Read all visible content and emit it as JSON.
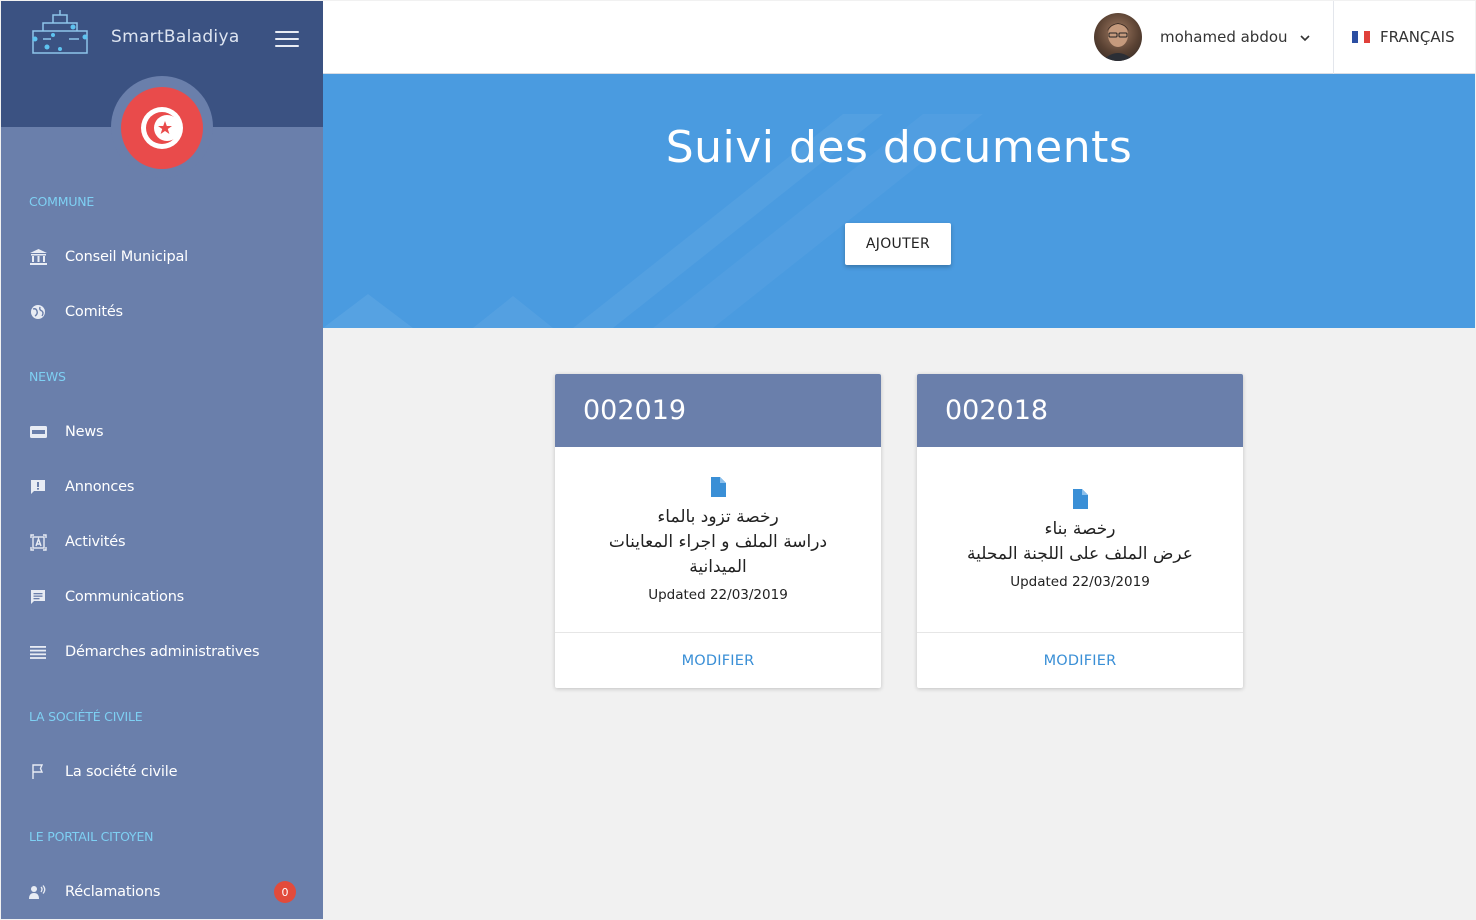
{
  "app": {
    "brand": "SmartBaladiya"
  },
  "sidebar": {
    "sections": [
      {
        "title": "COMMUNE",
        "items": [
          {
            "label": "Conseil Municipal",
            "icon": "bank-icon"
          },
          {
            "label": "Comités",
            "icon": "globe-icon"
          }
        ]
      },
      {
        "title": "NEWS",
        "items": [
          {
            "label": "News",
            "icon": "new-badge-icon"
          },
          {
            "label": "Annonces",
            "icon": "announcement-icon"
          },
          {
            "label": "Activités",
            "icon": "activity-icon"
          },
          {
            "label": "Communications",
            "icon": "message-icon"
          },
          {
            "label": "Démarches administratives",
            "icon": "list-icon"
          }
        ]
      },
      {
        "title": "LA SOCIÉTÉ CIVILE",
        "items": [
          {
            "label": "La société civile",
            "icon": "flag-icon"
          }
        ]
      },
      {
        "title": "LE PORTAIL CITOYEN",
        "items": [
          {
            "label": "Réclamations",
            "icon": "speaker-person-icon",
            "badge": "0"
          }
        ]
      }
    ]
  },
  "topbar": {
    "user_name": "mohamed abdou",
    "language": "FRANÇAIS"
  },
  "hero": {
    "title": "Suivi des documents",
    "add_label": "AJOUTER"
  },
  "cards": [
    {
      "id": "002019",
      "line1": "رخصة تزود بالماء",
      "line2": "دراسة الملف و اجراء المعاينات الميدانية",
      "updated": "Updated 22/03/2019",
      "action": "MODIFIER"
    },
    {
      "id": "002018",
      "line1": "رخصة بناء",
      "line2": "عرض الملف على اللجنة المحلية",
      "updated": "Updated 22/03/2019",
      "action": "MODIFIER"
    }
  ],
  "colors": {
    "sidebar_bg": "#6a7fab",
    "sidebar_top": "#3b5282",
    "section_title": "#7ed0f3",
    "hero_bg": "#4a9be0",
    "card_head": "#6a7fab",
    "action": "#3a8fd6",
    "badge": "#e24b3b",
    "tunisia_red": "#e94b4b"
  }
}
